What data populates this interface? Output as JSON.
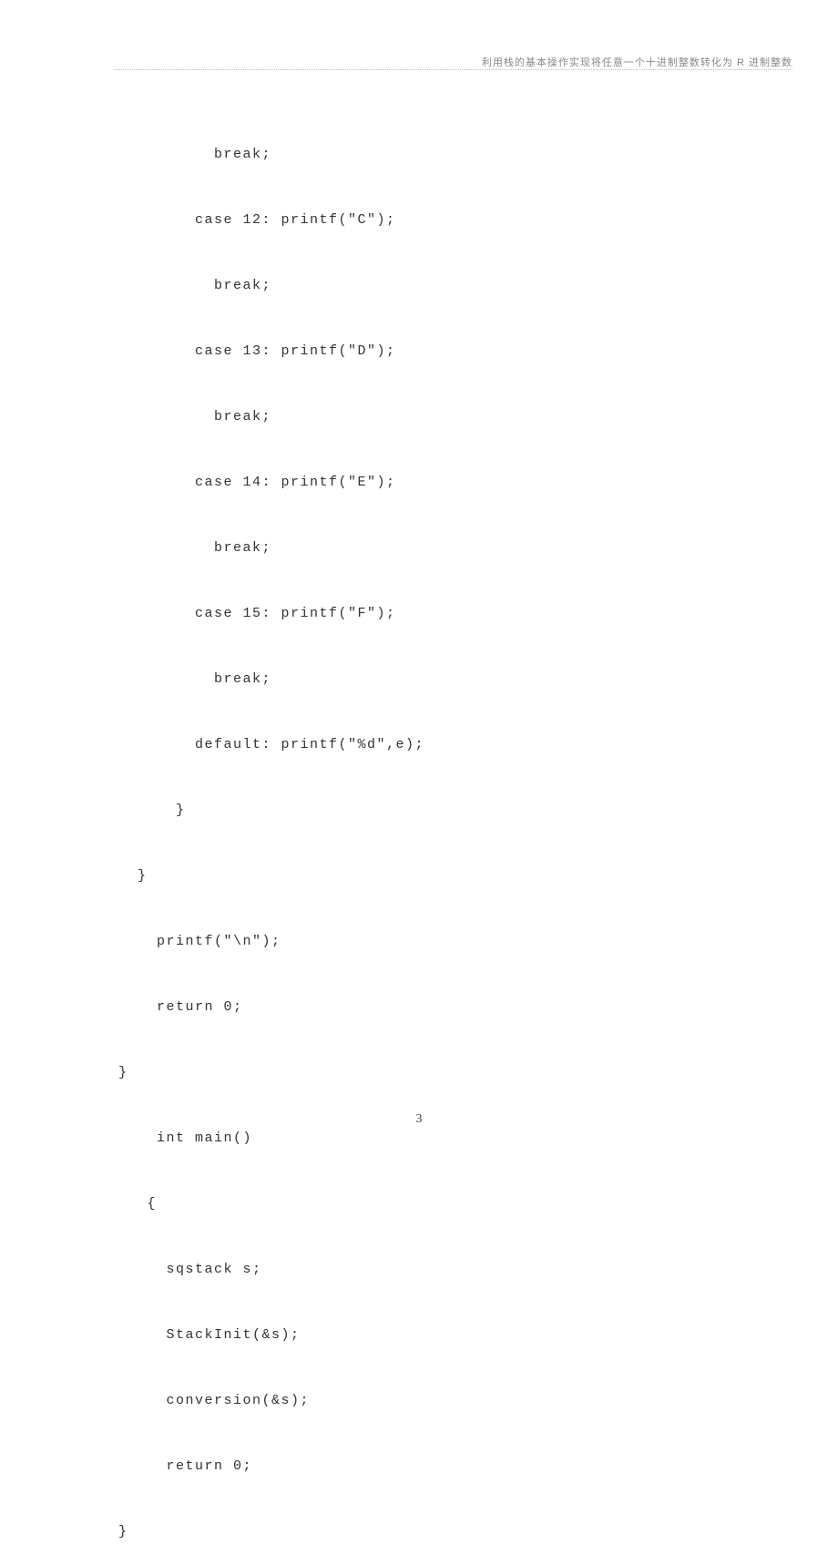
{
  "header": {
    "title": "利用栈的基本操作实现将任意一个十进制整数转化为 R 进制整数"
  },
  "code": {
    "lines": [
      "          break;",
      "        case 12: printf(\"C\");",
      "          break;",
      "        case 13: printf(\"D\");",
      "          break;",
      "        case 14: printf(\"E\");",
      "          break;",
      "        case 15: printf(\"F\");",
      "          break;",
      "        default: printf(\"%d\",e);",
      "      }",
      "  }",
      "    printf(\"\\n\");",
      "    return 0;",
      "}",
      "    int main()",
      "   {",
      "     sqstack s;",
      "     StackInit(&s);",
      "     conversion(&s);",
      "     return 0;",
      "}"
    ]
  },
  "footer": {
    "page_number": "3"
  }
}
